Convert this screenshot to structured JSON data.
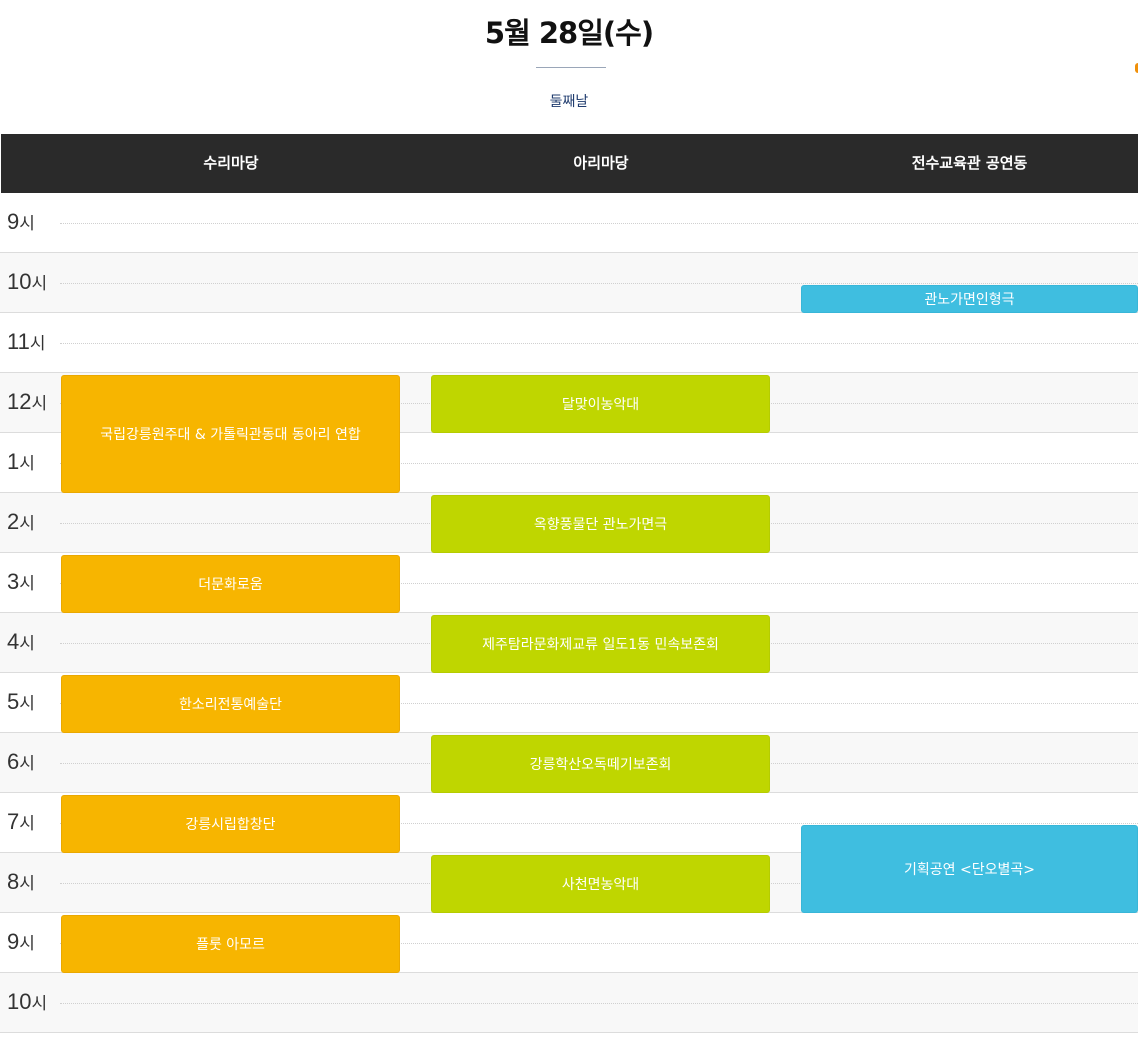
{
  "header": {
    "date_title": "5월 28일(수)",
    "day_label": "둘째날"
  },
  "venues": [
    "수리마당",
    "아리마당",
    "전수교육관 공연동"
  ],
  "hours": [
    {
      "num": "9",
      "suffix": "시"
    },
    {
      "num": "10",
      "suffix": "시"
    },
    {
      "num": "11",
      "suffix": "시"
    },
    {
      "num": "12",
      "suffix": "시"
    },
    {
      "num": "1",
      "suffix": "시"
    },
    {
      "num": "2",
      "suffix": "시"
    },
    {
      "num": "3",
      "suffix": "시"
    },
    {
      "num": "4",
      "suffix": "시"
    },
    {
      "num": "5",
      "suffix": "시"
    },
    {
      "num": "6",
      "suffix": "시"
    },
    {
      "num": "7",
      "suffix": "시"
    },
    {
      "num": "8",
      "suffix": "시"
    },
    {
      "num": "9",
      "suffix": "시"
    },
    {
      "num": "10",
      "suffix": "시"
    }
  ],
  "colors": {
    "venue_1": "#f7b500",
    "venue_2": "#bfd600",
    "venue_3": "#3fbee0"
  },
  "events": {
    "venue_3_a": "관노가면인형극",
    "venue_1_a": "국립강릉원주대 & 가톨릭관동대 동아리 연합",
    "venue_2_a": "달맞이농악대",
    "venue_2_b": "옥향풍물단 관노가면극",
    "venue_1_b": "더문화로움",
    "venue_2_c": "제주탐라문화제교류 일도1동 민속보존회",
    "venue_1_c": "한소리전통예술단",
    "venue_2_d": "강릉학산오독떼기보존회",
    "venue_1_d": "강릉시립합창단",
    "venue_3_b": "기획공연 <단오별곡>",
    "venue_2_e": "사천면농악대",
    "venue_1_e": "플룻 아모르"
  }
}
